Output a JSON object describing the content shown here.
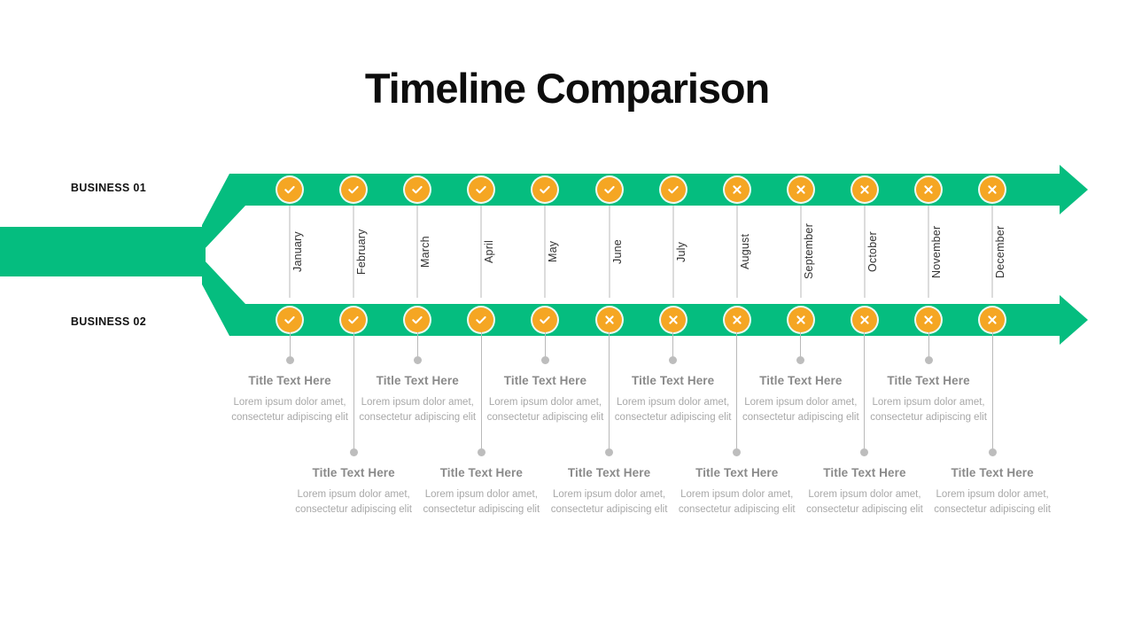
{
  "page": {
    "title": "Timeline Comparison"
  },
  "colors": {
    "arrow_green": "#05bd7f",
    "badge_orange": "#f5a623",
    "rule_gray": "#b9b9b9",
    "caption_title_gray": "#8a8a8a",
    "caption_body_gray": "#a8a8a8",
    "title_black": "#0d0d0d"
  },
  "rows": [
    {
      "id": "business-01",
      "label": "BUSINESS 01"
    },
    {
      "id": "business-02",
      "label": "BUSINESS 02"
    }
  ],
  "months": [
    "January",
    "February",
    "March",
    "April",
    "May",
    "June",
    "July",
    "August",
    "September",
    "October",
    "November",
    "December"
  ],
  "status": {
    "check_icon": "check-icon",
    "cross_icon": "cross-icon",
    "business_01": [
      "check-icon",
      "check-icon",
      "check-icon",
      "check-icon",
      "check-icon",
      "check-icon",
      "check-icon",
      "cross-icon",
      "cross-icon",
      "cross-icon",
      "cross-icon",
      "cross-icon"
    ],
    "business_02": [
      "check-icon",
      "check-icon",
      "check-icon",
      "check-icon",
      "check-icon",
      "cross-icon",
      "cross-icon",
      "cross-icon",
      "cross-icon",
      "cross-icon",
      "cross-icon",
      "cross-icon"
    ]
  },
  "captions": {
    "upper": [
      {
        "title": "Title Text Here",
        "body": "Lorem ipsum dolor amet, consectetur adipiscing elit"
      },
      {
        "title": "Title Text Here",
        "body": "Lorem ipsum dolor amet, consectetur adipiscing elit"
      },
      {
        "title": "Title Text Here",
        "body": "Lorem ipsum dolor amet, consectetur adipiscing elit"
      },
      {
        "title": "Title Text Here",
        "body": "Lorem ipsum dolor amet, consectetur adipiscing elit"
      },
      {
        "title": "Title Text Here",
        "body": "Lorem ipsum dolor amet, consectetur adipiscing elit"
      },
      {
        "title": "Title Text Here",
        "body": "Lorem ipsum dolor amet, consectetur adipiscing elit"
      }
    ],
    "lower": [
      {
        "title": "Title Text Here",
        "body": "Lorem ipsum dolor amet, consectetur adipiscing elit"
      },
      {
        "title": "Title Text Here",
        "body": "Lorem ipsum dolor amet, consectetur adipiscing elit"
      },
      {
        "title": "Title Text Here",
        "body": "Lorem ipsum dolor amet, consectetur adipiscing elit"
      },
      {
        "title": "Title Text Here",
        "body": "Lorem ipsum dolor amet, consectetur adipiscing elit"
      },
      {
        "title": "Title Text Here",
        "body": "Lorem ipsum dolor amet, consectetur adipiscing elit"
      },
      {
        "title": "Title Text Here",
        "body": "Lorem ipsum dolor amet, consectetur adipiscing elit"
      }
    ]
  }
}
